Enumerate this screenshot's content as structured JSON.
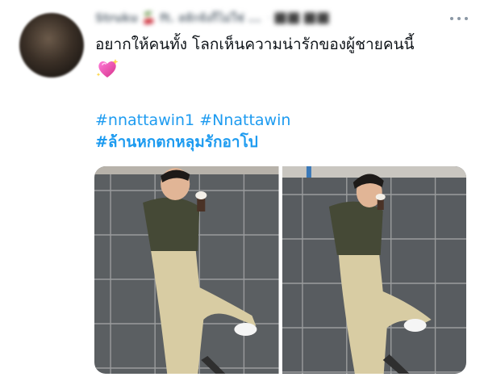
{
  "tweet": {
    "author_name": "Struku 🍒 ft. สลักจังก็ไม่ใช่ ...",
    "author_handle": "· ⬛⬛ ⬛⬛",
    "text": "อยากให้คนทั้ง โลกเห็นความน่ารักของผู้ชายคนนี้",
    "emoji": "sparkling-heart-icon",
    "hashtags": [
      "#nnattawin1",
      "#Nnattawin",
      "#ล้านหกตกหลุมรักอาโป"
    ],
    "media": [
      {
        "description": "photo-1"
      },
      {
        "description": "photo-2"
      }
    ]
  },
  "colors": {
    "link": "#1d9bf0",
    "text": "#0f1419",
    "muted": "#8b98a5"
  }
}
